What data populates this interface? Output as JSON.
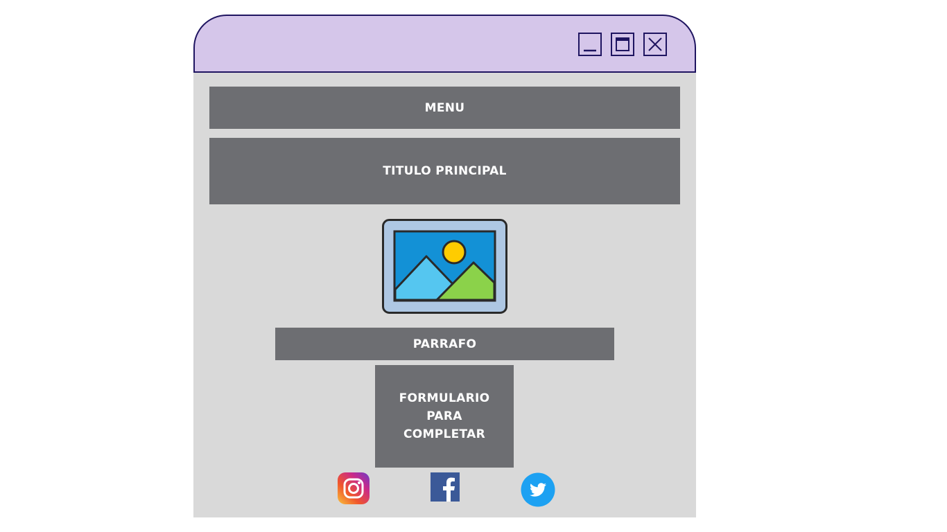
{
  "window": {
    "controls": {
      "minimize": "minimize",
      "maximize": "maximize",
      "close": "close"
    }
  },
  "layout_blocks": {
    "menu_label": "MENU",
    "title_label": "TITULO PRINCIPAL",
    "paragraph_label": "PARRAFO",
    "form_label": "FORMULARIO PARA\nCOMPLETAR"
  },
  "image_placeholder": {
    "icon": "image-icon"
  },
  "social_links": [
    {
      "name": "instagram",
      "icon": "instagram-icon"
    },
    {
      "name": "facebook",
      "icon": "facebook-icon"
    },
    {
      "name": "twitter",
      "icon": "twitter-icon"
    }
  ],
  "colors": {
    "titlebar": "#d5c6ea",
    "titlebar_border": "#1e1460",
    "body": "#d9d9d9",
    "block": "#6d6e72",
    "block_text": "#ffffff"
  }
}
